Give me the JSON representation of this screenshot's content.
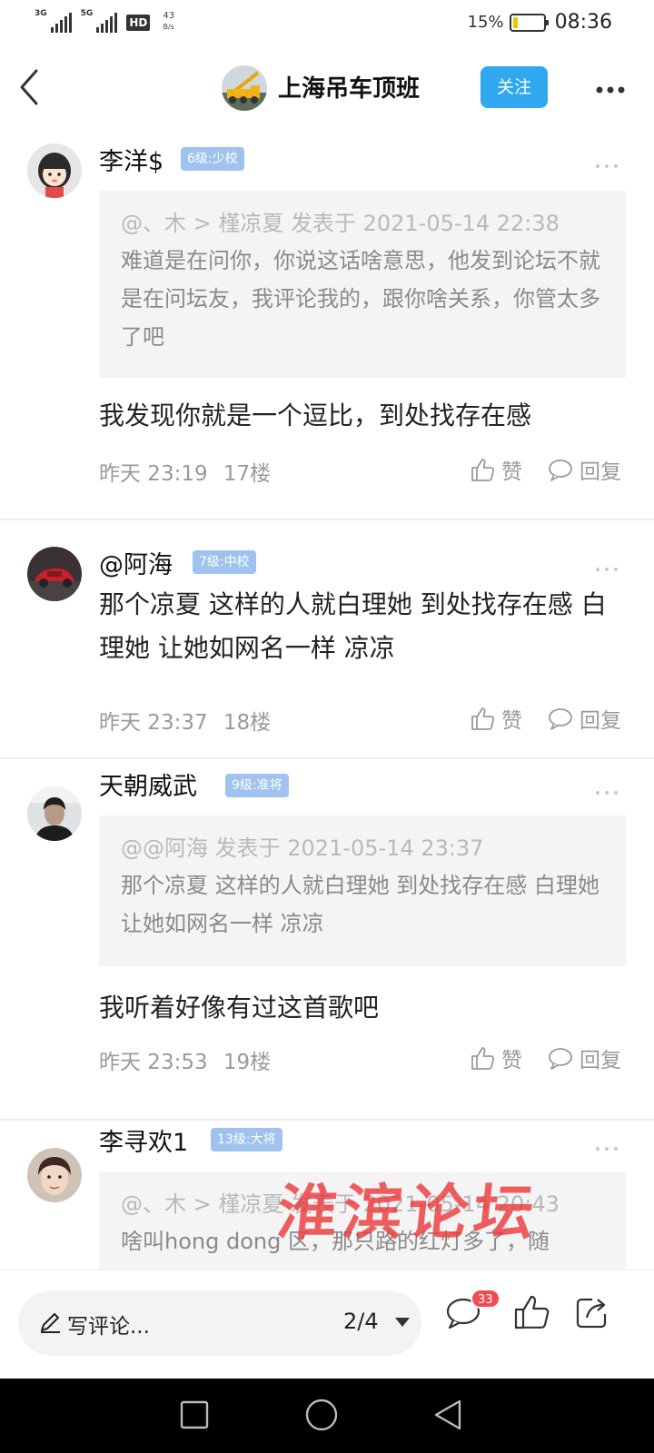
{
  "status_bar": {
    "signal_1": "3G",
    "signal_2": "5G",
    "hd": "HD",
    "speed_value": "43",
    "speed_unit": "B/s",
    "battery_pct": "15%",
    "battery_level": 0.15,
    "battery_color": "#f2c400",
    "time": "08:36"
  },
  "header": {
    "back_icon": "chevron-left-icon",
    "forum_name": "上海吊车顶班",
    "follow_label": "关注",
    "more_icon": "more-horizontal-icon",
    "accent": "#2fa8f0"
  },
  "comments": [
    {
      "username": "李洋$",
      "badge": "6级:少校",
      "quote_head": "@、木 > 槿凉夏 发表于 2021-05-14 22:38",
      "quote_body": "难道是在问你，你说这话啥意思，他发到论坛不就是在问坛友，我评论我的，跟你啥关系，你管太多了吧",
      "text": "我发现你就是一个逗比，到处找存在感",
      "time": "昨天 23:19",
      "floor": "17楼",
      "like_label": "赞",
      "reply_label": "回复"
    },
    {
      "username": "@阿海",
      "badge": "7级:中校",
      "text": "那个凉夏 这样的人就白理她 到处找存在感 白理她 让她如网名一样 凉凉",
      "time": "昨天 23:37",
      "floor": "18楼",
      "like_label": "赞",
      "reply_label": "回复"
    },
    {
      "username": "天朝威武",
      "badge": "9级:准将",
      "quote_head": "@@阿海 发表于 2021-05-14 23:37",
      "quote_body": "那个凉夏 这样的人就白理她 到处找存在感 白理她 让她如网名一样 凉凉",
      "text": "我听着好像有过这首歌吧",
      "time": "昨天 23:53",
      "floor": "19楼",
      "like_label": "赞",
      "reply_label": "回复"
    },
    {
      "username": "李寻欢1",
      "badge": "13级:大将",
      "quote_head": "@、木 > 槿凉夏 发表于 2021-05-14 20:43",
      "quote_body": "啥叫hong dong 区，那只路的红灯多了，随"
    }
  ],
  "watermark": "淮滨论坛",
  "bottom_bar": {
    "placeholder": "写评论...",
    "page": "2/4",
    "comment_count": "33",
    "icons": [
      "comment-icon",
      "thumbs-up-icon",
      "share-icon"
    ]
  },
  "nav_bar": {
    "icons": [
      "recent-apps-icon",
      "home-icon",
      "back-icon"
    ]
  }
}
